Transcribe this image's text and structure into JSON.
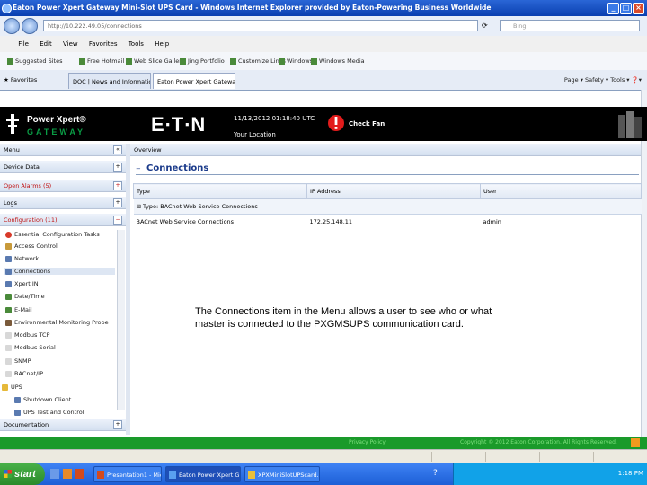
{
  "browser": {
    "title": "Eaton Power Xpert Gateway Mini-Slot UPS Card - Windows Internet Explorer provided by Eaton-Powering Business Worldwide",
    "address": "http://10.222.49.05/connections",
    "search_placeholder": "Bing",
    "menu": [
      "File",
      "Edit",
      "View",
      "Favorites",
      "Tools",
      "Help"
    ],
    "links": [
      "Suggested Sites",
      "Free Hotmail",
      "Web Slice Gallery",
      "Jing Portfolio",
      "Customize Links",
      "Windows",
      "Windows Media"
    ],
    "favorites_label": "Favorites",
    "tabs": [
      {
        "label": "DOC | News and Information",
        "active": false
      },
      {
        "label": "Eaton Power Xpert Gateway",
        "active": true
      }
    ],
    "tools": "Page ▾  Safety ▾  Tools ▾  ❓▾"
  },
  "header": {
    "brand_top": "Power Xpert®",
    "brand_bottom": "GATEWAY",
    "company": "E∙T∙N",
    "datetime": "11/13/2012 01:18:40 UTC",
    "location": "Your Location",
    "alarm": "Check Fan"
  },
  "menu": {
    "title": "Menu",
    "sections": [
      {
        "label": "Device Data"
      },
      {
        "label": "Open Alarms (5)"
      },
      {
        "label": "Logs"
      },
      {
        "label": "Configuration (11)"
      }
    ],
    "items": [
      "Essential Configuration Tasks",
      "Access Control",
      "Network",
      "Connections",
      "Xpert IN",
      "Date/Time",
      "E-Mail",
      "Environmental Monitoring Probe",
      "Modbus TCP",
      "Modbus Serial",
      "SNMP",
      "BACnet/IP",
      "UPS",
      "Shutdown Client",
      "UPS Test and Control"
    ],
    "documentation": "Documentation"
  },
  "overview": {
    "title": "Overview",
    "section_title": "Connections",
    "columns": [
      "Type",
      "IP Address",
      "User"
    ],
    "group": "Type: BACnet Web Service Connections",
    "rows": [
      {
        "type": "BACnet Web Service Connections",
        "ip": "172.25.148.11",
        "user": "admin"
      }
    ]
  },
  "annotation": "The Connections item in the Menu allows a user to see who or what master is connected to the PXGMSUPS communication card.",
  "footer": {
    "left": "Privacy Policy",
    "right": "Copyright © 2012 Eaton Corporation. All Rights Reserved."
  },
  "taskbar": {
    "start": "start",
    "buttons": [
      "Presentation1 - Micro...",
      "Eaton Power Xpert G...",
      "XPXMiniSlotUPScard..."
    ],
    "clock": "1:18 PM"
  }
}
